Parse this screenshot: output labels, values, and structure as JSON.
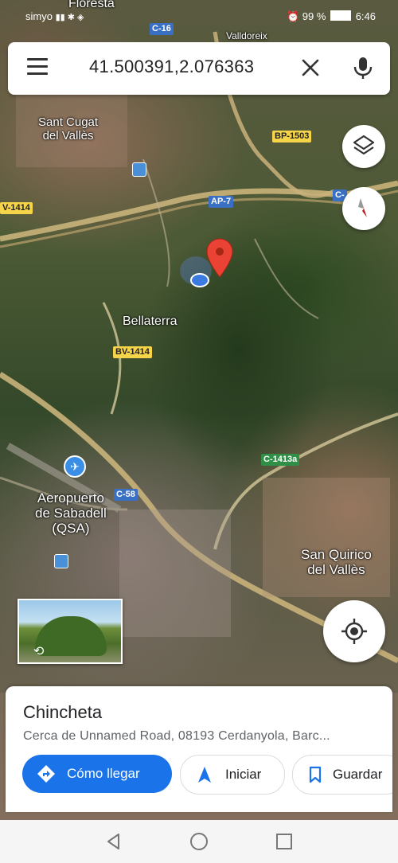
{
  "status_bar": {
    "carrier": "simyo",
    "battery": "99 %",
    "time": "6:46"
  },
  "search": {
    "query": "41.500391,2.076363",
    "menu_icon": "hamburger-menu-icon",
    "clear_icon": "close-icon",
    "mic_icon": "microphone-icon"
  },
  "map": {
    "labels": {
      "floresta": "Floresta",
      "valldoreix": "Valldoreix",
      "sant_cugat": "Sant Cugat\ndel Vallès",
      "bellaterra": "Bellaterra",
      "aeropuerto": "Aeropuerto\nde Sabadell\n(QSA)",
      "san_quirico": "San Quirico\ndel Vallès"
    },
    "shields": {
      "c16": "C-16",
      "bp1503": "BP-1503",
      "ap7": "AP-7",
      "c_right": "C-",
      "bv1414_left": "V-1414",
      "bv1414": "BV-1414",
      "c1413a": "C-1413a",
      "c58": "C-58"
    },
    "pin_icon": "location-pin-icon",
    "my_location_icon": "current-location-dot-icon"
  },
  "controls": {
    "layers_icon": "layers-icon",
    "compass_icon": "compass-icon",
    "locate_icon": "my-location-icon"
  },
  "place": {
    "title": "Chincheta",
    "address": "Cerca de Unnamed Road, 08193 Cerdanyola, Barc...",
    "directions_label": "Cómo llegar",
    "start_label": "Iniciar",
    "save_label": "Guardar"
  },
  "colors": {
    "accent": "#1a73e8",
    "pin": "#ea4335"
  }
}
